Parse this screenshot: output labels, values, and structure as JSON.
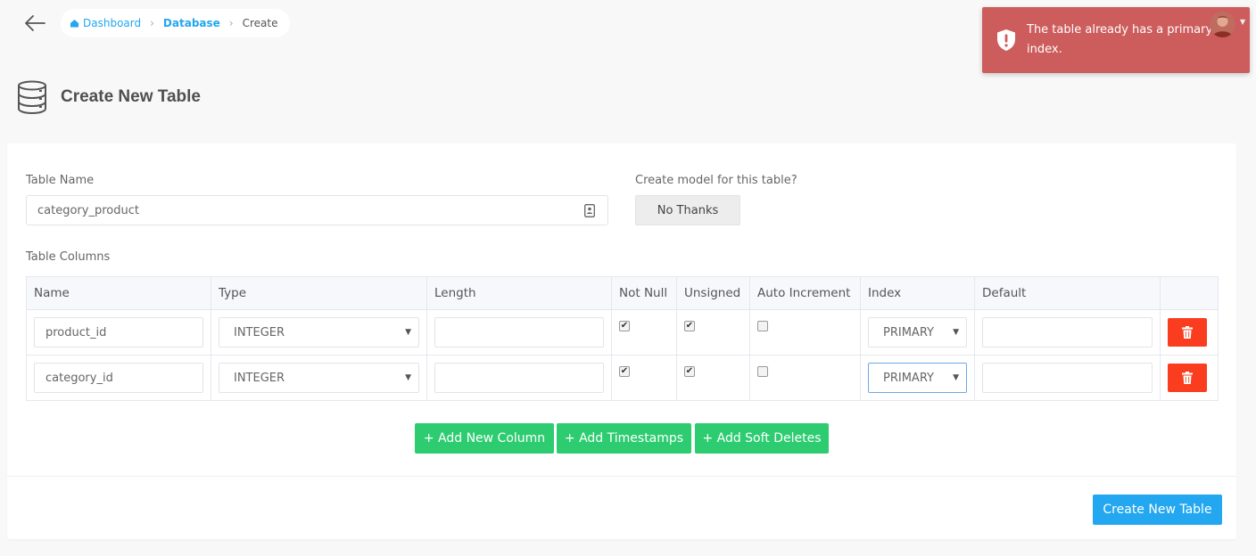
{
  "breadcrumb": {
    "items": [
      "Dashboard",
      "Database"
    ],
    "current": "Create"
  },
  "page": {
    "title": "Create New Table"
  },
  "form": {
    "table_name_label": "Table Name",
    "table_name_value": "category_product",
    "model_label": "Create model for this table?",
    "model_button": "No Thanks",
    "columns_label": "Table Columns"
  },
  "columns": {
    "headers": [
      "Name",
      "Type",
      "Length",
      "Not Null",
      "Unsigned",
      "Auto Increment",
      "Index",
      "Default"
    ],
    "rows": [
      {
        "name": "product_id",
        "type": "INTEGER",
        "length": "",
        "not_null": true,
        "unsigned": true,
        "auto_increment": false,
        "index": "PRIMARY",
        "default": ""
      },
      {
        "name": "category_id",
        "type": "INTEGER",
        "length": "",
        "not_null": true,
        "unsigned": true,
        "auto_increment": false,
        "index": "PRIMARY",
        "default": ""
      }
    ]
  },
  "actions": {
    "add_column": "+ Add New Column",
    "add_timestamps": "+ Add Timestamps",
    "add_soft_deletes": "+ Add Soft Deletes",
    "create_table": "Create New Table"
  },
  "toast": {
    "message": "The table already has a primary index."
  },
  "colors": {
    "accent": "#22a7f0",
    "success": "#2ecc71",
    "danger": "#fa3d1e",
    "toast": "#cd5c5c"
  },
  "icons": {
    "back": "arrow-left-icon",
    "home": "dashboard-icon",
    "title": "database-icon",
    "input": "contact-card-icon",
    "delete": "trash-icon",
    "toast": "shield-alert-icon"
  }
}
